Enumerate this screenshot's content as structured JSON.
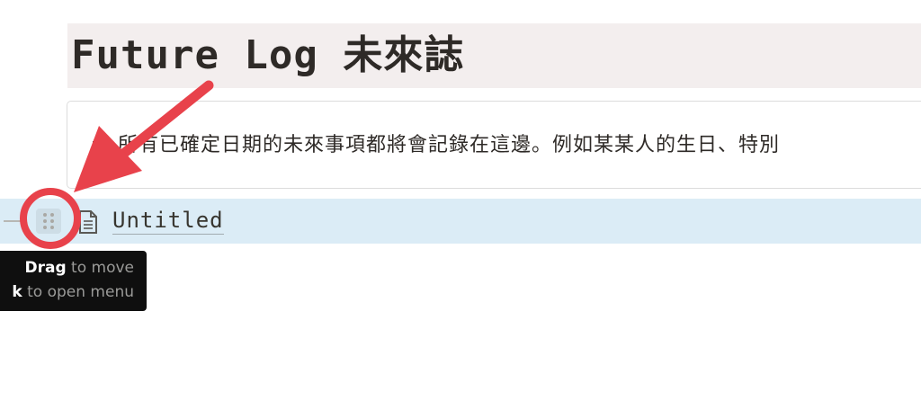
{
  "page": {
    "heading": "Future Log 未來誌"
  },
  "callout": {
    "icon": "speaker-icon",
    "text": "所有已確定日期的未來事項都將會記錄在這邊。例如某某人的生日、特別"
  },
  "block": {
    "title": "Untitled",
    "page_icon": "page-icon",
    "handle_icon": "drag-handle-icon",
    "add_icon": "plus-icon"
  },
  "tooltip": {
    "line1_key": "Drag",
    "line1_rest": " to move",
    "line2_key": "k",
    "line2_rest": " to open menu"
  },
  "colors": {
    "heading_bg": "#f3eeee",
    "selected_row": "#dbecf6",
    "annotation": "#e8424b",
    "tooltip_bg": "#0f0f0f"
  }
}
